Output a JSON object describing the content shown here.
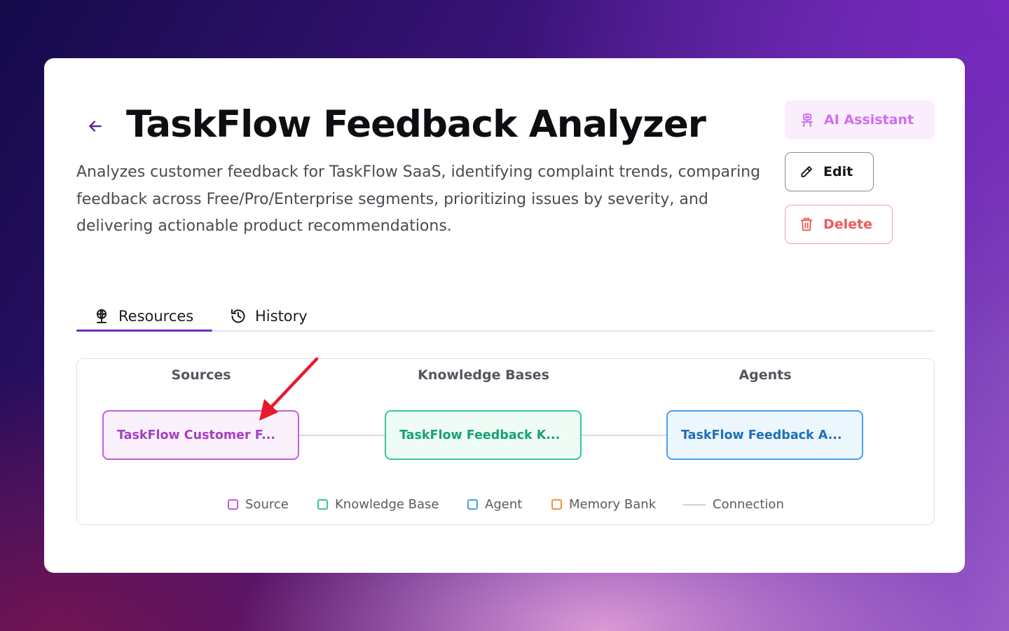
{
  "header": {
    "title": "TaskFlow Feedback Analyzer",
    "description": "Analyzes customer feedback for TaskFlow SaaS, identifying complaint trends, comparing feedback across Free/Pro/Enterprise segments, prioritizing issues by severity, and delivering actionable product recommendations."
  },
  "actions": {
    "ai_label": "AI Assistant",
    "edit_label": "Edit",
    "delete_label": "Delete"
  },
  "tabs": [
    {
      "label": "Resources",
      "icon": "globe-stand-icon",
      "active": true
    },
    {
      "label": "History",
      "icon": "history-icon",
      "active": false
    }
  ],
  "graph": {
    "columns": [
      "Sources",
      "Knowledge Bases",
      "Agents"
    ],
    "nodes": {
      "source": "TaskFlow Customer F...",
      "knowledge_base": "TaskFlow Feedback K...",
      "agent": "TaskFlow Feedback A..."
    },
    "legend": [
      {
        "label": "Source",
        "color": "#c55ce0"
      },
      {
        "label": "Knowledge Base",
        "color": "#38c692"
      },
      {
        "label": "Agent",
        "color": "#46a2ec"
      },
      {
        "label": "Memory Bank",
        "color": "#f0913a"
      },
      {
        "label": "Connection",
        "color": "#d0d0d8"
      }
    ]
  },
  "colors": {
    "accent": "#6b2fbf",
    "annotation_arrow": "#e8192c"
  }
}
